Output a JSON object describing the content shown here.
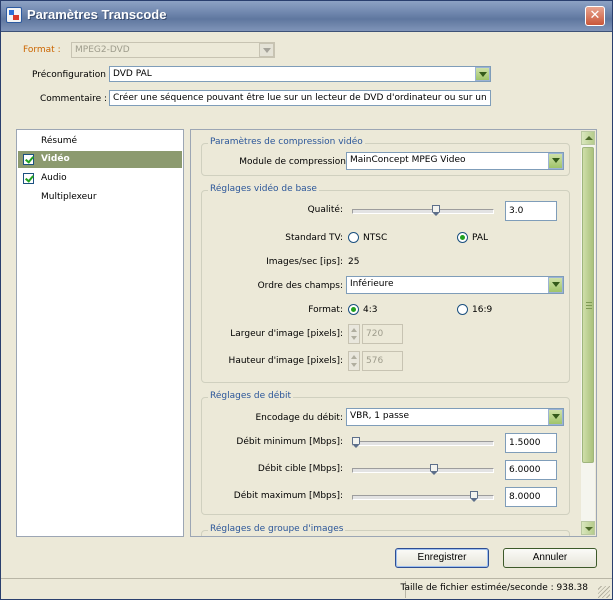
{
  "window": {
    "title": "Paramètres Transcode",
    "close_label": "✕"
  },
  "top": {
    "format_label": "Format :",
    "format_value": "MPEG2-DVD",
    "preset_label": "Préconfiguration",
    "preset_value": "DVD PAL",
    "comment_label": "Commentaire :",
    "comment_value": "Créer une séquence pouvant être lue sur un lecteur de DVD d'ordinateur ou sur un lecteu"
  },
  "sidebar": {
    "items": [
      {
        "label": "Résumé",
        "checked": false
      },
      {
        "label": "Vidéo",
        "checked": true
      },
      {
        "label": "Audio",
        "checked": true
      },
      {
        "label": "Multiplexeur",
        "checked": false
      }
    ]
  },
  "compression": {
    "group_title": "Paramètres de compression vidéo",
    "codec_label": "Module de compression:",
    "codec_value": "MainConcept MPEG Video"
  },
  "basic": {
    "group_title": "Réglages vidéo de base",
    "quality_label": "Qualité:",
    "quality_value": "3.0",
    "quality_fraction": 0.6,
    "tv_label": "Standard TV:",
    "tv_ntsc": "NTSC",
    "tv_pal": "PAL",
    "tv_selected": "PAL",
    "fps_label": "Images/sec [ips]:",
    "fps_value": "25",
    "field_label": "Ordre des champs:",
    "field_value": "Inférieure",
    "aspect_label": "Format:",
    "aspect_43": "4:3",
    "aspect_169": "16:9",
    "aspect_selected": "4:3",
    "width_label": "Largeur d'image [pixels]:",
    "width_value": "720",
    "height_label": "Hauteur d'image [pixels]:",
    "height_value": "576"
  },
  "bitrate": {
    "group_title": "Réglages de débit",
    "encoding_label": "Encodage du débit:",
    "encoding_value": "VBR, 1 passe",
    "min_label": "Débit minimum [Mbps]:",
    "min_value": "1.5000",
    "min_fraction": 0.0,
    "target_label": "Débit cible [Mbps]:",
    "target_value": "6.0000",
    "target_fraction": 0.58,
    "max_label": "Débit maximum [Mbps]:",
    "max_value": "8.0000",
    "max_fraction": 0.88
  },
  "gop": {
    "group_title": "Réglages de groupe d'images"
  },
  "buttons": {
    "save": "Enregistrer",
    "cancel": "Annuler"
  },
  "status": {
    "text": "Taille de fichier estimée/seconde : 938.38"
  }
}
